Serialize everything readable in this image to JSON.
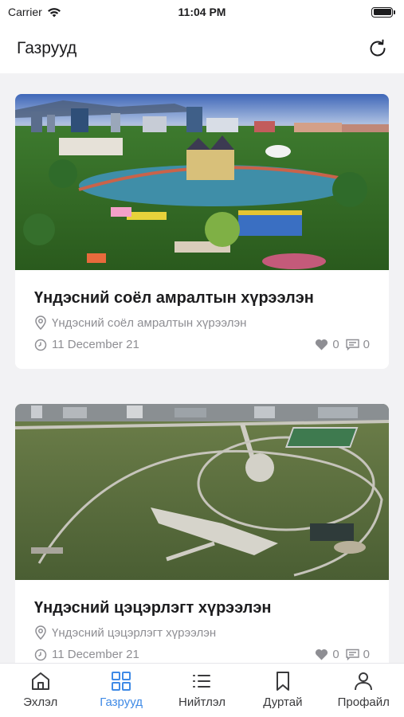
{
  "status_bar": {
    "carrier": "Carrier",
    "time": "11:04 PM"
  },
  "header": {
    "title": "Газрууд"
  },
  "places": [
    {
      "title": "Үндэсний соёл амралтын хүрээлэн",
      "location": "Үндэсний соёл амралтын хүрээлэн",
      "date": "11 December 21",
      "likes": "0",
      "comments": "0"
    },
    {
      "title": "Үндэсний цэцэрлэгт хүрээлэн",
      "location": "Үндэсний цэцэрлэгт хүрээлэн",
      "date": "11 December 21",
      "likes": "0",
      "comments": "0"
    }
  ],
  "tabbar": {
    "items": [
      {
        "label": "Эхлэл",
        "icon": "home-icon"
      },
      {
        "label": "Газрууд",
        "icon": "grid-icon",
        "active": true
      },
      {
        "label": "Нийтлэл",
        "icon": "list-icon"
      },
      {
        "label": "Дуртай",
        "icon": "bookmark-icon"
      },
      {
        "label": "Профайл",
        "icon": "profile-icon"
      }
    ]
  },
  "colors": {
    "accent": "#3f8ae6",
    "text_primary": "#1c1c1e",
    "text_secondary": "#8e8e93",
    "background": "#f2f2f4"
  }
}
